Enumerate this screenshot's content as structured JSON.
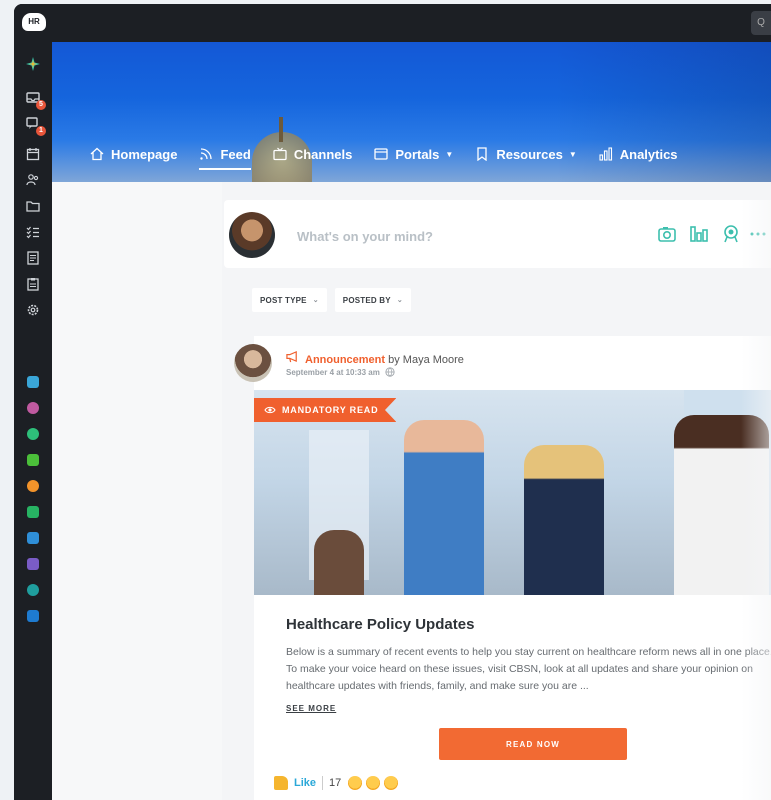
{
  "app": {
    "logo_text": "HR",
    "top_button_label": "Q"
  },
  "sidebar": {
    "badges": {
      "inbox": "5",
      "chat": "1"
    }
  },
  "nav": {
    "items": [
      {
        "label": "Homepage",
        "icon": "home-icon"
      },
      {
        "label": "Feed",
        "icon": "rss-icon",
        "active": true
      },
      {
        "label": "Channels",
        "icon": "tv-icon"
      },
      {
        "label": "Portals",
        "icon": "window-icon",
        "dropdown": true
      },
      {
        "label": "Resources",
        "icon": "bookmark-icon",
        "dropdown": true
      },
      {
        "label": "Analytics",
        "icon": "bar-chart-icon"
      }
    ]
  },
  "composer": {
    "placeholder": "What's on your mind?"
  },
  "filters": {
    "post_type": "POST TYPE",
    "posted_by": "POSTED BY"
  },
  "post": {
    "category": "Announcement",
    "by_text": " by Maya Moore",
    "date": "September 4 at 10:33 am",
    "ribbon": "MANDATORY READ",
    "title": "Healthcare Policy Updates",
    "body": "Below is a summary of recent events to help you stay current on healthcare reform news all in one place. To make your voice heard on these issues, visit CBSN, look at all updates and share your opinion on healthcare updates with friends, family, and make sure you are ...",
    "see_more": "SEE MORE",
    "cta": "READ NOW",
    "like_label": "Like",
    "reaction_count": "17"
  },
  "colors": {
    "accent": "#f26a33",
    "link": "#2aa8d8",
    "hero": "#1565dd"
  }
}
